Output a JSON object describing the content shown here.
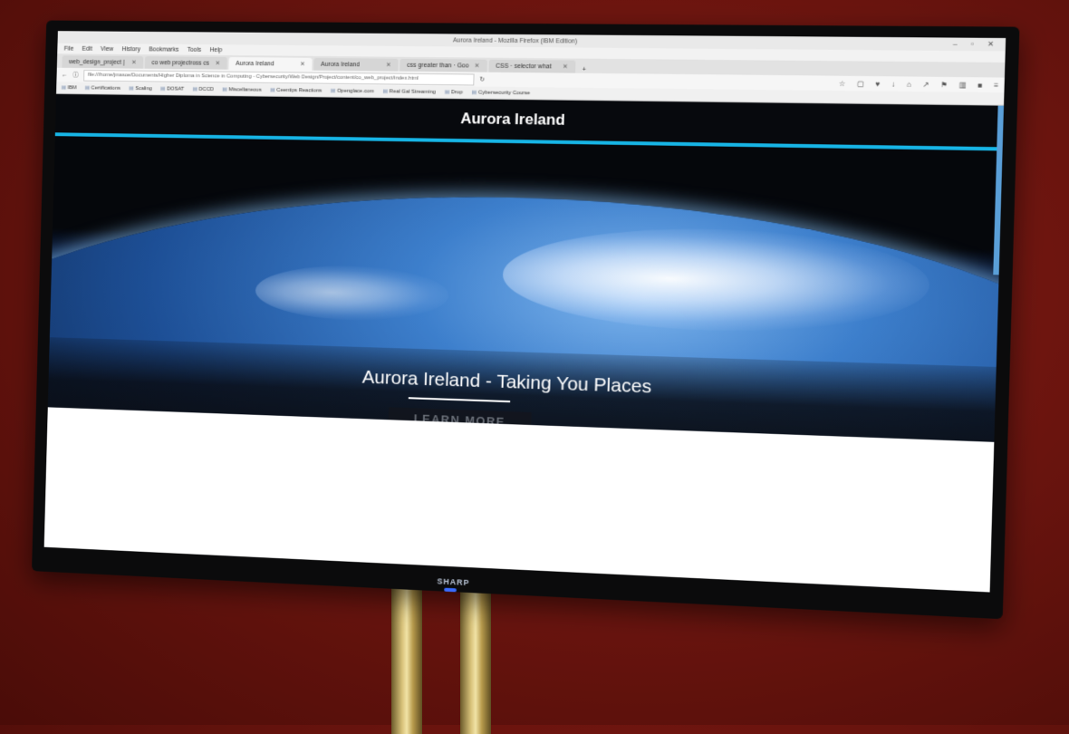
{
  "browser": {
    "window_title": "Aurora Ireland - Mozilla Firefox (IBM Edition)",
    "menu": [
      "File",
      "Edit",
      "View",
      "History",
      "Bookmarks",
      "Tools",
      "Help"
    ],
    "tabs": [
      {
        "label": "web_design_project |"
      },
      {
        "label": "co web projectross cs"
      },
      {
        "label": "Aurora Ireland"
      },
      {
        "label": "Aurora Ireland"
      },
      {
        "label": "css greater than · Goo"
      },
      {
        "label": "CSS · selector what"
      }
    ],
    "url": "file:///home/jmasoe/Documents/Higher Diploma in Science in Computing - Cybersecurity/Web Design/Project/content/co_web_project/index.html",
    "bookmarks": [
      "IBM",
      "Certifications",
      "Scaling",
      "DOSAT",
      "DCCD",
      "Miscellaneous",
      "Ceentips Reactions",
      "Openglace.com",
      "Real Gal Streaming",
      "Drop",
      "Cybersecurity Course"
    ]
  },
  "site": {
    "title": "Aurora Ireland",
    "tagline": "Aurora Ireland - Taking You Places",
    "cta_label": "LEARN MORE"
  },
  "tv": {
    "brand": "SHARP"
  },
  "colors": {
    "accent": "#17b5e6",
    "header_bg": "#07090d"
  }
}
